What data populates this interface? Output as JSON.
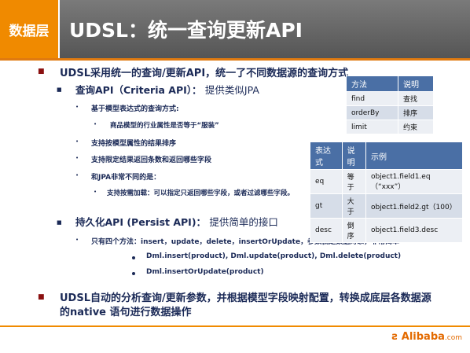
{
  "header": {
    "section": "数据层",
    "title": "UDSL：统一查询更新API"
  },
  "bullets": {
    "main1": "UDSL采用统一的查询/更新API，统一了不同数据源的查询方式",
    "query_api": "查询API（Criteria API）：",
    "query_api_desc": "提供类似JPA",
    "query_style": "基于模型表达式的查询方式:",
    "query_example": "商品模型的行业属性是否等于“服装”",
    "sort_support": "支持按模型属性的结果排序",
    "limit_support": "支持限定结果返回条数和返回哪些字段",
    "jpa_diff": "和JPA非常不同的是：",
    "on_demand": "支持按需加载：可以指定只返回哪些字段，或者过滤哪些字段。",
    "persist_api": "持久化API (Persist API)：",
    "persist_api_desc": "提供简单的接口",
    "four_methods": "只有四个方法：insert，update，delete，insertOrUpdate，参数就是数据对象，非常简单",
    "dml1": "Dml.insert(product), Dml.update(product), Dml.delete(product)",
    "dml2": "Dml.insertOrUpdate(product)",
    "main2_line1": "UDSL自动的分析查询/更新参数，并根据模型字段映射配置，转换成底层各数据源",
    "main2_line2": "的native 语句进行数据操作"
  },
  "methods_table": {
    "headers": [
      "方法",
      "说明"
    ],
    "rows": [
      [
        "find",
        "查找"
      ],
      [
        "orderBy",
        "排序"
      ],
      [
        "limit",
        "约束"
      ]
    ]
  },
  "expr_table": {
    "headers": [
      "表达式",
      "说明",
      "示例"
    ],
    "rows": [
      [
        "eq",
        "等于",
        "object1.field1.eq（“xxx”）"
      ],
      [
        "gt",
        "大于",
        "object1.field2.gt（100）"
      ],
      [
        "desc",
        "倒序",
        "object1.field3.desc"
      ]
    ]
  },
  "logo": {
    "brand": "Alibaba",
    "suffix": ".com"
  },
  "colors": {
    "orange": "#f08a00",
    "header_gray": "#666666",
    "table_header": "#4a6fa5",
    "text": "#1b2a57"
  }
}
